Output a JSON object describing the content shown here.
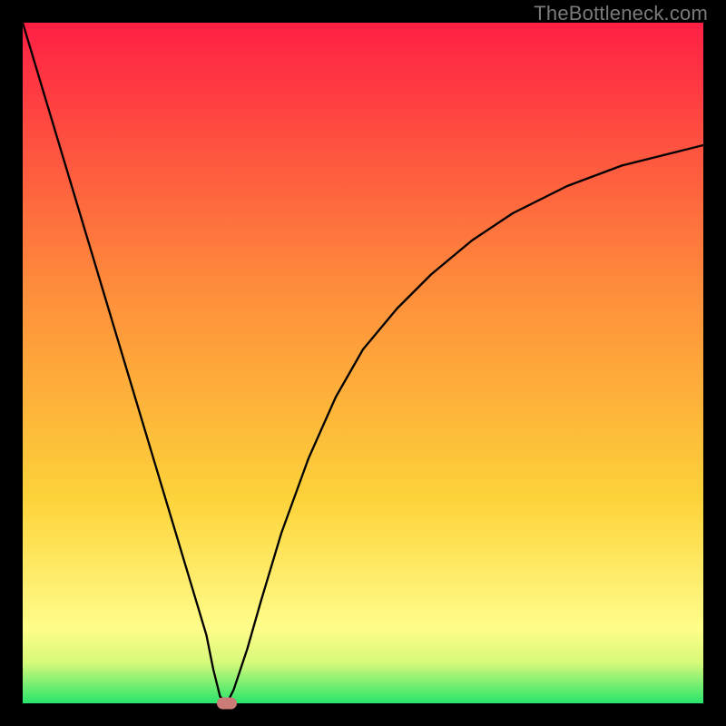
{
  "watermark": "TheBottleneck.com",
  "chart_data": {
    "type": "line",
    "title": "",
    "xlabel": "",
    "ylabel": "",
    "xlim": [
      0,
      100
    ],
    "ylim": [
      0,
      100
    ],
    "grid": false,
    "legend": false,
    "background_gradient": {
      "top_color": "#ff1f44",
      "mid_color": "#fdd33a",
      "bottom_highlight": "#fffd8a",
      "bottom_color": "#27e56a"
    },
    "series": [
      {
        "name": "bottleneck-curve",
        "color": "#000000",
        "x": [
          0,
          3,
          6,
          9,
          12,
          15,
          18,
          21,
          24,
          27,
          28,
          29,
          30,
          31,
          33,
          35,
          38,
          42,
          46,
          50,
          55,
          60,
          66,
          72,
          80,
          88,
          96,
          100
        ],
        "y": [
          100,
          90,
          80,
          70,
          60,
          50,
          40,
          30,
          20,
          10,
          5,
          1,
          0,
          2,
          8,
          15,
          25,
          36,
          45,
          52,
          58,
          63,
          68,
          72,
          76,
          79,
          81,
          82
        ]
      }
    ],
    "marker": {
      "name": "optimal-point",
      "x": 30,
      "y": 0,
      "color": "#cb7c76"
    }
  }
}
